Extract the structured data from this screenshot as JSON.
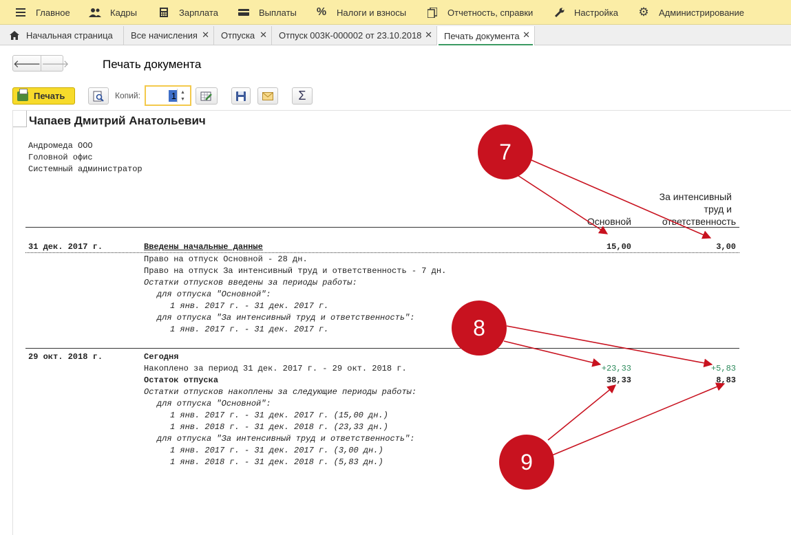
{
  "menu": [
    {
      "label": "Главное",
      "icon": "hamburger-icon"
    },
    {
      "label": "Кадры",
      "icon": "people-icon"
    },
    {
      "label": "Зарплата",
      "icon": "calculator-icon"
    },
    {
      "label": "Выплаты",
      "icon": "wallet-icon"
    },
    {
      "label": "Налоги и взносы",
      "icon": "percent-icon"
    },
    {
      "label": "Отчетность, справки",
      "icon": "reports-icon"
    },
    {
      "label": "Настройка",
      "icon": "wrench-icon"
    },
    {
      "label": "Администрирование",
      "icon": "gear-icon"
    }
  ],
  "tabs": [
    {
      "label": "Начальная страница",
      "closable": false
    },
    {
      "label": "Все начисления",
      "closable": true
    },
    {
      "label": "Отпуска",
      "closable": true
    },
    {
      "label": "Отпуск 003К-000002 от 23.10.2018",
      "closable": true
    },
    {
      "label": "Печать документа",
      "closable": true,
      "active": true
    }
  ],
  "header": {
    "title": "Печать документа"
  },
  "toolbar": {
    "print_label": "Печать",
    "copies_label": "Копий:",
    "copies_value": "1",
    "sum_symbol": "Σ"
  },
  "report": {
    "employee": "Чапаев Дмитрий Анатольевич",
    "org": [
      "Андромеда ООО",
      "Головной офис",
      "Системный администратор"
    ],
    "col1": "Основной",
    "col2": [
      "За интенсивный",
      "труд и",
      "ответственность"
    ],
    "block1": {
      "date": "31 дек. 2017 г.",
      "title": "Введены начальные данные",
      "v1": "15,00",
      "v2": "3,00",
      "lines": [
        "Право на отпуск Основной - 28 дн.",
        "Право на отпуск За интенсивный труд и ответственность - 7 дн.",
        "Остатки отпусков введены за периоды работы:",
        "для отпуска \"Основной\":",
        "1 янв. 2017 г. - 31 дек. 2017 г.",
        "для отпуска \"За интенсивный труд и ответственность\":",
        "1 янв. 2017 г. - 31 дек. 2017 г."
      ]
    },
    "block2": {
      "date": "29 окт. 2018 г.",
      "title": "Сегодня",
      "accrued": "Накоплено за период 31 дек. 2017 г. - 29 окт. 2018 г.",
      "accrued_v1": "+23,33",
      "accrued_v2": "+5,83",
      "balance": "Остаток отпуска",
      "balance_v1": "38,33",
      "balance_v2": "8,83",
      "lines": [
        "Остатки отпусков накоплены за следующие периоды работы:",
        "для отпуска \"Основной\":",
        "1 янв. 2017 г. - 31 дек. 2017 г. (15,00 дн.)",
        "1 янв. 2018 г. - 31 дек. 2018 г. (23,33 дн.)",
        "для отпуска \"За интенсивный труд и ответственность\":",
        "1 янв. 2017 г. - 31 дек. 2017 г. (3,00 дн.)",
        "1 янв. 2018 г. - 31 дек. 2018 г. (5,83 дн.)"
      ]
    }
  },
  "callouts": [
    "7",
    "8",
    "9"
  ],
  "colors": {
    "menu_bg": "#fbeda6",
    "print_button": "#f7db2b",
    "callout": "#c8121f",
    "accrual": "#2d8a5c",
    "active_tab_line": "#3b9a62"
  }
}
